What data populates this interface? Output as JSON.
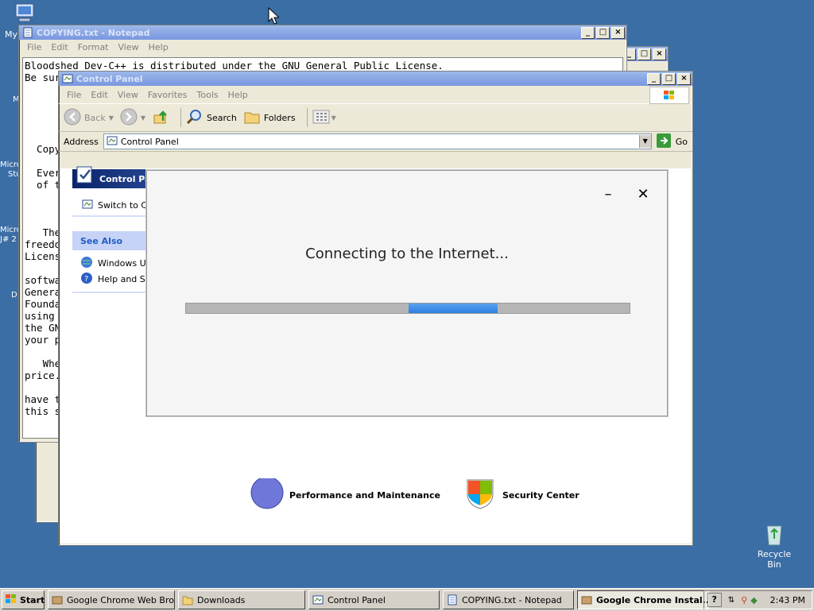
{
  "desktop": {
    "icons": [
      {
        "label": "My"
      },
      {
        "label": "Recycle Bin"
      }
    ],
    "left_labels": [
      "M",
      "Micro",
      "Stu",
      "Micro",
      "J# 2",
      "D"
    ]
  },
  "notepad": {
    "title": "COPYING.txt - Notepad",
    "menu": [
      "File",
      "Edit",
      "Format",
      "View",
      "Help"
    ],
    "lines": [
      "Bloodshed Dev-C++ is distributed under the GNU General Public License.",
      "Be sur",
      "",
      "",
      "",
      "",
      "",
      "  Copyr",
      "",
      "  Every",
      "  of th",
      "",
      "",
      "",
      "   The",
      "freedo",
      "Licens",
      "",
      "softwa",
      "Genera",
      "Founda",
      "using ",
      "the GN",
      "your p",
      "",
      "   When",
      "price.",
      "",
      "have t",
      "this s"
    ]
  },
  "controlpanel": {
    "title": "Control Panel",
    "menu": [
      "File",
      "Edit",
      "View",
      "Favorites",
      "Tools",
      "Help"
    ],
    "toolbar": {
      "back": "Back",
      "search": "Search",
      "folders": "Folders"
    },
    "address_label": "Address",
    "address_value": "Control Panel",
    "go": "Go",
    "pane_title": "Control Par",
    "switch": "Switch to Cla",
    "see_also": "See Also",
    "see_also_items": [
      "Windows Up",
      "Help and Sup"
    ],
    "categories": [
      "Performance and Maintenance",
      "Security Center"
    ]
  },
  "dialog": {
    "message": "Connecting to the Internet...",
    "progress_fraction": 0.2
  },
  "taskbar": {
    "start": "Start",
    "items": [
      "Google Chrome Web Bro...",
      "Downloads",
      "Control Panel",
      "COPYING.txt - Notepad",
      "Google Chrome Instal..."
    ],
    "clock": "2:43 PM"
  },
  "colors": {
    "desktop": "#3a6ea5",
    "titlebar_active": "#0a246a",
    "progress": "#2f7ee0"
  }
}
